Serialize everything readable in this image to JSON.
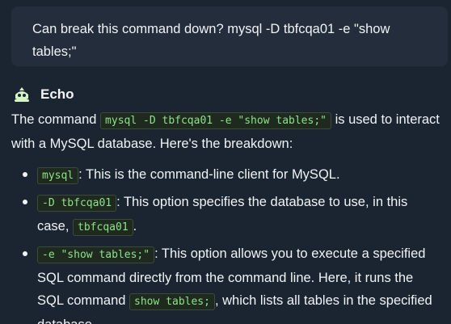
{
  "user_message": {
    "text": "Can break this command down? mysql -D tbfcqa01 -e \"show tables;\""
  },
  "assistant": {
    "name": "Echo",
    "icon": "robot-icon",
    "intro": {
      "before": "The command ",
      "code": "mysql -D tbfcqa01 -e \"show tables;\"",
      "after": " is used to interact with a MySQL database. Here's the breakdown:"
    },
    "bullets": [
      {
        "code": "mysql",
        "text": ": This is the command-line client for MySQL."
      },
      {
        "code": "-D tbfcqa01",
        "text": ": This option specifies the database to use, in this case, ",
        "code2": "tbfcqa01",
        "text2": "."
      },
      {
        "code": "-e \"show tables;\"",
        "text": ": This option allows you to execute a specified SQL command directly from the command line. Here, it runs the SQL command ",
        "code2": "show tables;",
        "text2": ", which lists all tables in the specified database."
      }
    ]
  },
  "colors": {
    "background": "#1b2532",
    "bubble": "#232d3b",
    "code_text": "#8ee28b",
    "avatar_accent": "#d6f5c6"
  }
}
